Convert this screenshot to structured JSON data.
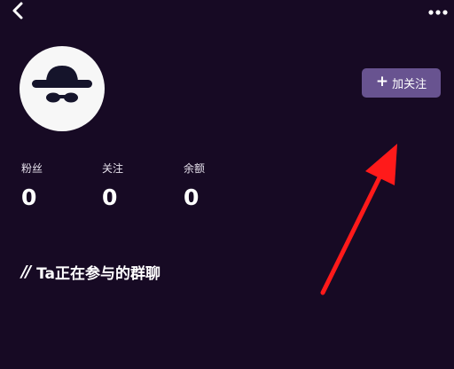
{
  "header": {
    "back_icon": "chevron-left-icon",
    "more_icon": "more-horizontal-icon"
  },
  "profile": {
    "avatar_icon": "incognito-hat-glasses-icon",
    "follow_button": {
      "plus": "+",
      "label": "加关注"
    }
  },
  "stats": [
    {
      "label": "粉丝",
      "value": "0"
    },
    {
      "label": "关注",
      "value": "0"
    },
    {
      "label": "余额",
      "value": "0"
    }
  ],
  "section": {
    "marker": "//",
    "title": "Ta正在参与的群聊"
  },
  "colors": {
    "background": "#170a24",
    "follow_button_bg": "#685390",
    "avatar_bg": "#f7f7f7",
    "avatar_icon": "#15142b",
    "annotation_arrow": "#ff1a1a"
  }
}
